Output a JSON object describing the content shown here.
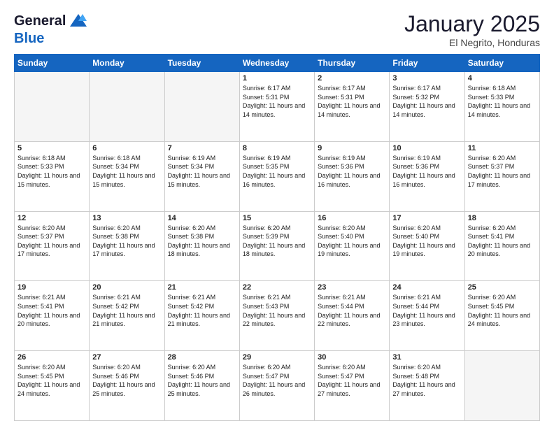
{
  "logo": {
    "general": "General",
    "blue": "Blue"
  },
  "header": {
    "month": "January 2025",
    "location": "El Negrito, Honduras"
  },
  "weekdays": [
    "Sunday",
    "Monday",
    "Tuesday",
    "Wednesday",
    "Thursday",
    "Friday",
    "Saturday"
  ],
  "weeks": [
    [
      {
        "day": "",
        "info": ""
      },
      {
        "day": "",
        "info": ""
      },
      {
        "day": "",
        "info": ""
      },
      {
        "day": "1",
        "info": "Sunrise: 6:17 AM\nSunset: 5:31 PM\nDaylight: 11 hours\nand 14 minutes."
      },
      {
        "day": "2",
        "info": "Sunrise: 6:17 AM\nSunset: 5:31 PM\nDaylight: 11 hours\nand 14 minutes."
      },
      {
        "day": "3",
        "info": "Sunrise: 6:17 AM\nSunset: 5:32 PM\nDaylight: 11 hours\nand 14 minutes."
      },
      {
        "day": "4",
        "info": "Sunrise: 6:18 AM\nSunset: 5:33 PM\nDaylight: 11 hours\nand 14 minutes."
      }
    ],
    [
      {
        "day": "5",
        "info": "Sunrise: 6:18 AM\nSunset: 5:33 PM\nDaylight: 11 hours\nand 15 minutes."
      },
      {
        "day": "6",
        "info": "Sunrise: 6:18 AM\nSunset: 5:34 PM\nDaylight: 11 hours\nand 15 minutes."
      },
      {
        "day": "7",
        "info": "Sunrise: 6:19 AM\nSunset: 5:34 PM\nDaylight: 11 hours\nand 15 minutes."
      },
      {
        "day": "8",
        "info": "Sunrise: 6:19 AM\nSunset: 5:35 PM\nDaylight: 11 hours\nand 16 minutes."
      },
      {
        "day": "9",
        "info": "Sunrise: 6:19 AM\nSunset: 5:36 PM\nDaylight: 11 hours\nand 16 minutes."
      },
      {
        "day": "10",
        "info": "Sunrise: 6:19 AM\nSunset: 5:36 PM\nDaylight: 11 hours\nand 16 minutes."
      },
      {
        "day": "11",
        "info": "Sunrise: 6:20 AM\nSunset: 5:37 PM\nDaylight: 11 hours\nand 17 minutes."
      }
    ],
    [
      {
        "day": "12",
        "info": "Sunrise: 6:20 AM\nSunset: 5:37 PM\nDaylight: 11 hours\nand 17 minutes."
      },
      {
        "day": "13",
        "info": "Sunrise: 6:20 AM\nSunset: 5:38 PM\nDaylight: 11 hours\nand 17 minutes."
      },
      {
        "day": "14",
        "info": "Sunrise: 6:20 AM\nSunset: 5:38 PM\nDaylight: 11 hours\nand 18 minutes."
      },
      {
        "day": "15",
        "info": "Sunrise: 6:20 AM\nSunset: 5:39 PM\nDaylight: 11 hours\nand 18 minutes."
      },
      {
        "day": "16",
        "info": "Sunrise: 6:20 AM\nSunset: 5:40 PM\nDaylight: 11 hours\nand 19 minutes."
      },
      {
        "day": "17",
        "info": "Sunrise: 6:20 AM\nSunset: 5:40 PM\nDaylight: 11 hours\nand 19 minutes."
      },
      {
        "day": "18",
        "info": "Sunrise: 6:20 AM\nSunset: 5:41 PM\nDaylight: 11 hours\nand 20 minutes."
      }
    ],
    [
      {
        "day": "19",
        "info": "Sunrise: 6:21 AM\nSunset: 5:41 PM\nDaylight: 11 hours\nand 20 minutes."
      },
      {
        "day": "20",
        "info": "Sunrise: 6:21 AM\nSunset: 5:42 PM\nDaylight: 11 hours\nand 21 minutes."
      },
      {
        "day": "21",
        "info": "Sunrise: 6:21 AM\nSunset: 5:42 PM\nDaylight: 11 hours\nand 21 minutes."
      },
      {
        "day": "22",
        "info": "Sunrise: 6:21 AM\nSunset: 5:43 PM\nDaylight: 11 hours\nand 22 minutes."
      },
      {
        "day": "23",
        "info": "Sunrise: 6:21 AM\nSunset: 5:44 PM\nDaylight: 11 hours\nand 22 minutes."
      },
      {
        "day": "24",
        "info": "Sunrise: 6:21 AM\nSunset: 5:44 PM\nDaylight: 11 hours\nand 23 minutes."
      },
      {
        "day": "25",
        "info": "Sunrise: 6:20 AM\nSunset: 5:45 PM\nDaylight: 11 hours\nand 24 minutes."
      }
    ],
    [
      {
        "day": "26",
        "info": "Sunrise: 6:20 AM\nSunset: 5:45 PM\nDaylight: 11 hours\nand 24 minutes."
      },
      {
        "day": "27",
        "info": "Sunrise: 6:20 AM\nSunset: 5:46 PM\nDaylight: 11 hours\nand 25 minutes."
      },
      {
        "day": "28",
        "info": "Sunrise: 6:20 AM\nSunset: 5:46 PM\nDaylight: 11 hours\nand 25 minutes."
      },
      {
        "day": "29",
        "info": "Sunrise: 6:20 AM\nSunset: 5:47 PM\nDaylight: 11 hours\nand 26 minutes."
      },
      {
        "day": "30",
        "info": "Sunrise: 6:20 AM\nSunset: 5:47 PM\nDaylight: 11 hours\nand 27 minutes."
      },
      {
        "day": "31",
        "info": "Sunrise: 6:20 AM\nSunset: 5:48 PM\nDaylight: 11 hours\nand 27 minutes."
      },
      {
        "day": "",
        "info": ""
      }
    ]
  ]
}
